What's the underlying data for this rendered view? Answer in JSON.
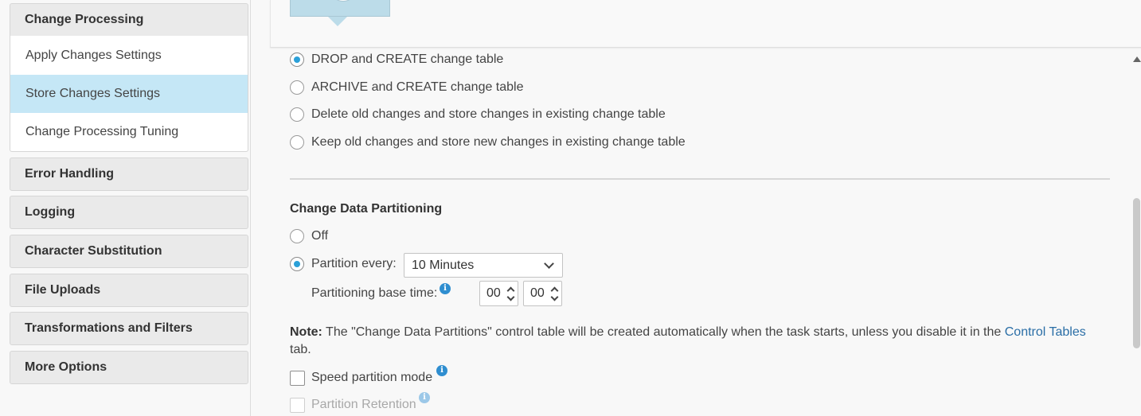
{
  "sidebar": {
    "sections": [
      {
        "label": "Change Processing",
        "expanded": true
      },
      {
        "label": "Error Handling"
      },
      {
        "label": "Logging"
      },
      {
        "label": "Character Substitution"
      },
      {
        "label": "File Uploads"
      },
      {
        "label": "Transformations and Filters"
      },
      {
        "label": "More Options"
      }
    ],
    "sub_items": [
      {
        "label": "Apply Changes Settings"
      },
      {
        "label": "Store Changes Settings",
        "active": true
      },
      {
        "label": "Change Processing Tuning"
      }
    ]
  },
  "change_table_options": [
    {
      "label": "DROP and CREATE change table",
      "selected": true
    },
    {
      "label": "ARCHIVE and CREATE change table",
      "selected": false
    },
    {
      "label": "Delete old changes and store changes in existing change table",
      "selected": false
    },
    {
      "label": "Keep old changes and store new changes in existing change table",
      "selected": false
    }
  ],
  "partitioning": {
    "title": "Change Data Partitioning",
    "off_label": "Off",
    "partition_every_label": "Partition every:",
    "interval_value": "10 Minutes",
    "base_time_label": "Partitioning base time:",
    "hours": "00",
    "minutes": "00"
  },
  "note": {
    "prefix": "Note:",
    "text": " The \"Change Data Partitions\" control table will be created automatically when the task starts, unless you disable it in the ",
    "link": "Control Tables",
    "suffix": " tab."
  },
  "speed_partition_label": "Speed partition mode",
  "partition_retention_label": "Partition Retention",
  "colors": {
    "accent": "#2ba0d8",
    "active_item_bg": "#c5e7f6",
    "link": "#2a6ea6"
  }
}
